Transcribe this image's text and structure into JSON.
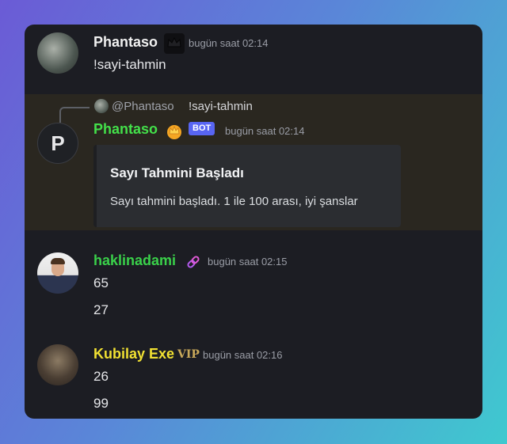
{
  "messages": [
    {
      "author": "Phantaso",
      "timestamp": "bugün saat 02:14",
      "content": "!sayi-tahmin",
      "badge_icon": "crown-icon"
    },
    {
      "reply": {
        "mention": "@Phantaso",
        "text": "!sayi-tahmin"
      },
      "author": "Phantaso",
      "avatar_letter": "P",
      "bot_tag": "BOT",
      "timestamp": "bugün saat 02:14",
      "author_color": "#43e04a",
      "embed": {
        "title": "Sayı Tahmini Başladı",
        "description": "Sayı tahmini başladı. 1 ile 100 arası, iyi şanslar"
      }
    },
    {
      "author": "haklinadami",
      "timestamp": "bugün saat 02:15",
      "author_color": "#3ad14a",
      "badge_icon": "link-icon",
      "lines": [
        "65",
        "27"
      ]
    },
    {
      "author": "Kubilay Exe",
      "badge_text": "VIP",
      "timestamp": "bugün saat 02:16",
      "author_color": "#f1e132",
      "lines": [
        "26",
        "99"
      ]
    }
  ],
  "colors": {
    "background": "#1c1d23",
    "highlight": "#2a2720",
    "bot_badge": "#5865f2"
  }
}
